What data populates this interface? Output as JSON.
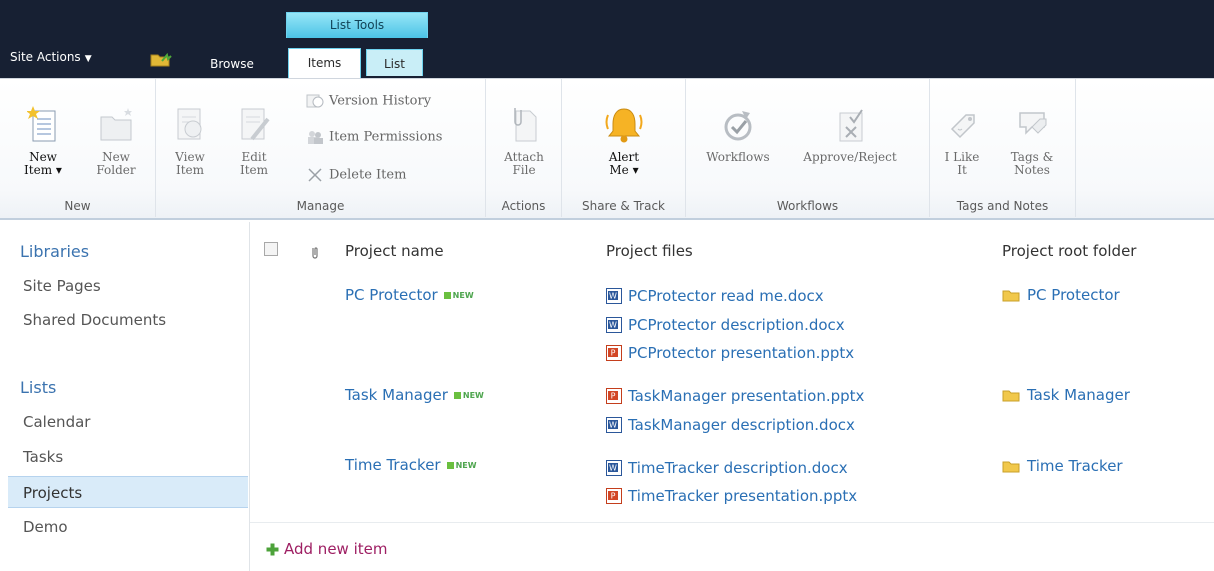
{
  "topbar": {
    "site_actions": "Site Actions",
    "tool_group": "List Tools",
    "tabs": [
      {
        "label": "Browse"
      },
      {
        "label": "Items"
      },
      {
        "label": "List"
      }
    ]
  },
  "ribbon": {
    "groups": {
      "new": "New",
      "manage": "Manage",
      "actions": "Actions",
      "share_track": "Share & Track",
      "workflows": "Workflows",
      "tags": "Tags and Notes"
    },
    "buttons": {
      "new_item": "New\nItem ▾",
      "new_folder": "New\nFolder",
      "view_item": "View\nItem",
      "edit_item": "Edit\nItem",
      "version_history": "Version History",
      "item_permissions": "Item Permissions",
      "delete_item": "Delete Item",
      "attach_file": "Attach\nFile",
      "alert_me": "Alert\nMe ▾",
      "workflows": "Workflows",
      "approve_reject": "Approve/Reject",
      "i_like_it": "I Like\nIt",
      "tags_notes": "Tags &\nNotes"
    }
  },
  "leftnav": {
    "libraries_heading": "Libraries",
    "libraries": [
      "Site Pages",
      "Shared Documents"
    ],
    "lists_heading": "Lists",
    "lists": [
      "Calendar",
      "Tasks",
      "Projects",
      "Demo"
    ],
    "selected": "Projects"
  },
  "list": {
    "columns": {
      "name": "Project name",
      "files": "Project files",
      "folder": "Project root folder"
    },
    "new_badge": "NEW",
    "rows": [
      {
        "name": "PC Protector",
        "files": [
          {
            "name": "PCProtector read me.docx",
            "type": "word"
          },
          {
            "name": "PCProtector description.docx",
            "type": "word"
          },
          {
            "name": "PCProtector presentation.pptx",
            "type": "powerpoint"
          }
        ],
        "folder": "PC Protector"
      },
      {
        "name": "Task Manager",
        "files": [
          {
            "name": "TaskManager presentation.pptx",
            "type": "powerpoint"
          },
          {
            "name": "TaskManager description.docx",
            "type": "word"
          }
        ],
        "folder": "Task Manager"
      },
      {
        "name": "Time Tracker",
        "files": [
          {
            "name": "TimeTracker description.docx",
            "type": "word"
          },
          {
            "name": "TimeTracker presentation.pptx",
            "type": "powerpoint"
          }
        ],
        "folder": "Time Tracker"
      }
    ],
    "add_new": "Add new item"
  },
  "colors": {
    "topbar": "#172033",
    "tool_tab": "#4bc3e6",
    "link": "#2a6fb4",
    "add_new": "#9e1f63",
    "selected_nav": "#d9ebf9"
  }
}
